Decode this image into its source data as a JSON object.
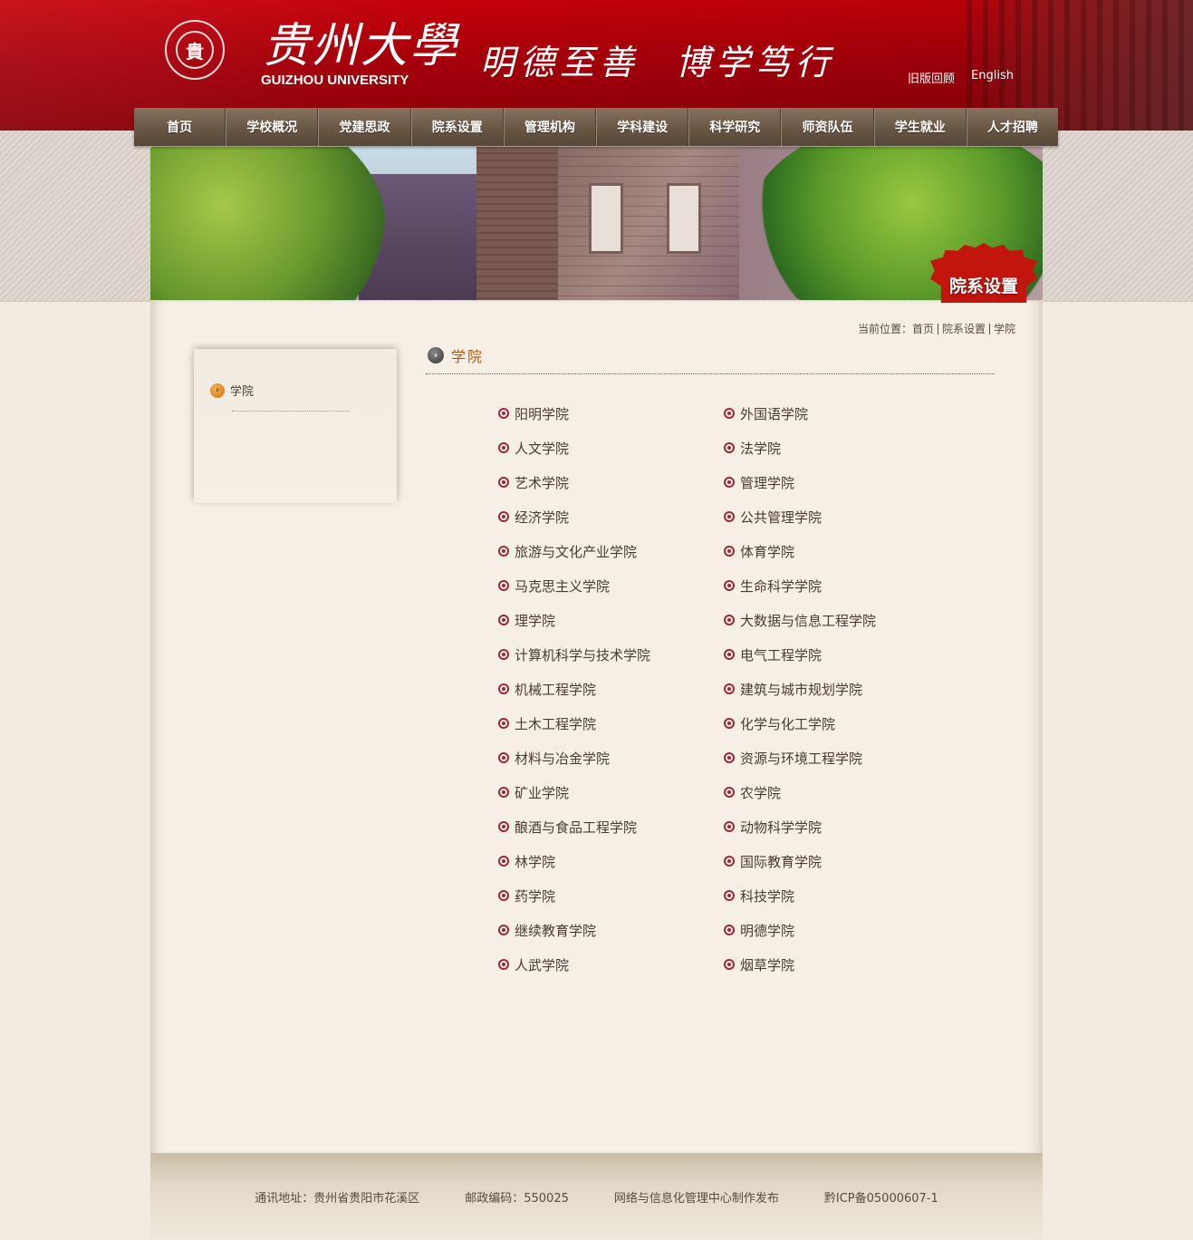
{
  "header": {
    "logo_cn": "贵州大學",
    "logo_en": "GUIZHOU UNIVERSITY",
    "seal_char": "貴",
    "motto_1": "明德至善",
    "motto_2": "博学笃行",
    "links": [
      "旧版回顾",
      "English"
    ]
  },
  "nav": {
    "items": [
      "首页",
      "学校概况",
      "党建思政",
      "院系设置",
      "管理机构",
      "学科建设",
      "科学研究",
      "师资队伍",
      "学生就业",
      "人才招聘"
    ]
  },
  "banner": {
    "badge": "院系设置"
  },
  "breadcrumb": {
    "prefix": "当前位置：",
    "items": [
      "首页",
      "院系设置",
      "学院"
    ]
  },
  "sidebar": {
    "items": [
      {
        "label": "学院"
      }
    ]
  },
  "content": {
    "title": "学院",
    "colleges": [
      "阳明学院",
      "外国语学院",
      "人文学院",
      "法学院",
      "艺术学院",
      "管理学院",
      "经济学院",
      "公共管理学院",
      "旅游与文化产业学院",
      "体育学院",
      "马克思主义学院",
      "生命科学学院",
      "理学院",
      "大数据与信息工程学院",
      "计算机科学与技术学院",
      "电气工程学院",
      "机械工程学院",
      "建筑与城市规划学院",
      "土木工程学院",
      "化学与化工学院",
      "材料与冶金学院",
      "资源与环境工程学院",
      "矿业学院",
      "农学院",
      "酿酒与食品工程学院",
      "动物科学学院",
      "林学院",
      "国际教育学院",
      "药学院",
      "科技学院",
      "继续教育学院",
      "明德学院",
      "人武学院",
      "烟草学院"
    ]
  },
  "footer": {
    "address": "通讯地址：贵州省贵阳市花溪区",
    "postcode": "邮政编码：550025",
    "publisher": "网络与信息化管理中心制作发布",
    "icp": "黔ICP备05000607-1"
  },
  "colors": {
    "header_red": "#b8000a",
    "nav_brown": "#6a5745",
    "title_orange": "#b45a10",
    "bullet_maroon": "#9a2a3a",
    "badge_red": "#c2150d"
  }
}
